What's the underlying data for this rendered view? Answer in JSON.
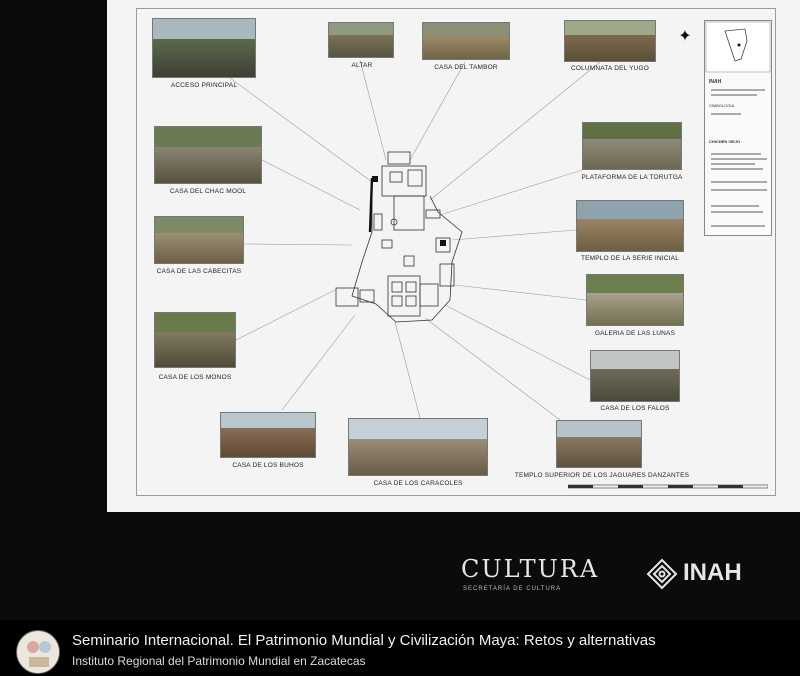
{
  "plan": {
    "photos": [
      {
        "label": "ACCESO PRINCIPAL"
      },
      {
        "label": "ALTAR"
      },
      {
        "label": "CASA DEL TAMBOR"
      },
      {
        "label": "COLUMNATA DEL YUGO"
      },
      {
        "label": "CASA DEL CHAC MOOL"
      },
      {
        "label": "PLATAFORMA DE LA TORUTGA"
      },
      {
        "label": "CASA DE LAS CABECITAS"
      },
      {
        "label": "TEMPLO DE LA SERIE INICIAL"
      },
      {
        "label": "GALERIA DE LAS LUNAS"
      },
      {
        "label": "CASA DE LOS MONOS"
      },
      {
        "label": "CASA DE LOS FALOS"
      },
      {
        "label": "CASA DE LOS BUHOS"
      },
      {
        "label": "CASA DE LOS CARACOLES"
      },
      {
        "label": "TEMPLO SUPERIOR DE LOS JAGUARES DANZANTES"
      }
    ],
    "colors": {
      "sheet": "#f4f4f4",
      "vegetation": "#5b6b3a",
      "stone": "#8e8574",
      "sky": "#b8c4cc"
    }
  },
  "title_block": {
    "institute": "INAH",
    "symbology": "SIMBOLOGIA",
    "site": "CHICHÉN VIEJO"
  },
  "logos": {
    "cultura": "CULTURA",
    "cultura_sub": "SECRETARÍA DE CULTURA",
    "inah": "INAH"
  },
  "video": {
    "title": "Seminario Internacional. El Patrimonio Mundial y Civilización Maya: Retos y alternativas",
    "channel": "Instituto Regional del Patrimonio Mundial en Zacatecas"
  }
}
